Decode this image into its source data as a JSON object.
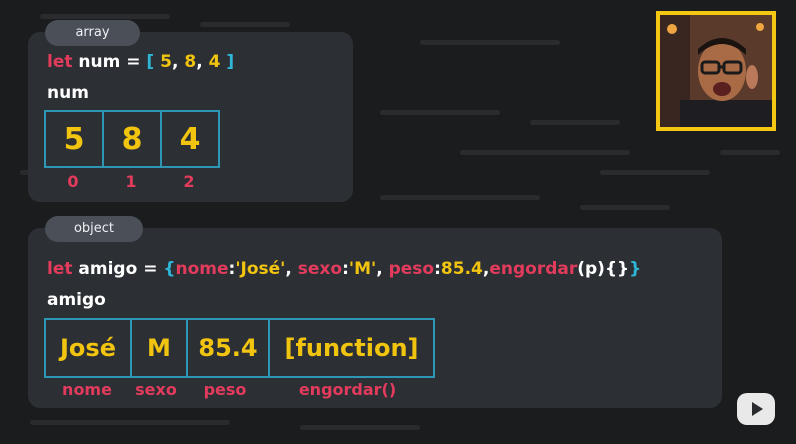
{
  "array_section": {
    "tag": "array",
    "code": {
      "keyword": "let",
      "varname": "num",
      "eq": "=",
      "open": "[",
      "v1": "5",
      "c1": ",",
      "v2": "8",
      "c2": ",",
      "v3": "4",
      "close": "]"
    },
    "var_label": "num",
    "cells": [
      "5",
      "8",
      "4"
    ],
    "indices": [
      "0",
      "1",
      "2"
    ]
  },
  "object_section": {
    "tag": "object",
    "code": {
      "keyword": "let",
      "varname": "amigo",
      "eq": "=",
      "open": "{",
      "k1": "nome",
      "colon1": ":",
      "v1": "'José'",
      "c1": ",",
      "k2": "sexo",
      "colon2": ":",
      "v2": "'M'",
      "c2": ",",
      "k3": "peso",
      "colon3": ":",
      "v3": "85.4",
      "c3": ",",
      "k4": "engordar",
      "paren_expr": "(p){}",
      "close": "}"
    },
    "var_label": "amigo",
    "cells": [
      "José",
      "M",
      "85.4",
      "[function]"
    ],
    "labels": [
      "nome",
      "sexo",
      "peso",
      "engordar()"
    ]
  },
  "colors": {
    "background": "#1b1c1e",
    "panel": "#2c2f34",
    "keyword": "#e23b5c",
    "bracket": "#2fb5d6",
    "value": "#f1c40f",
    "cell_border": "#2e97b5",
    "webcam_border": "#f3c712"
  },
  "icons": {
    "play_badge": "play-icon"
  }
}
